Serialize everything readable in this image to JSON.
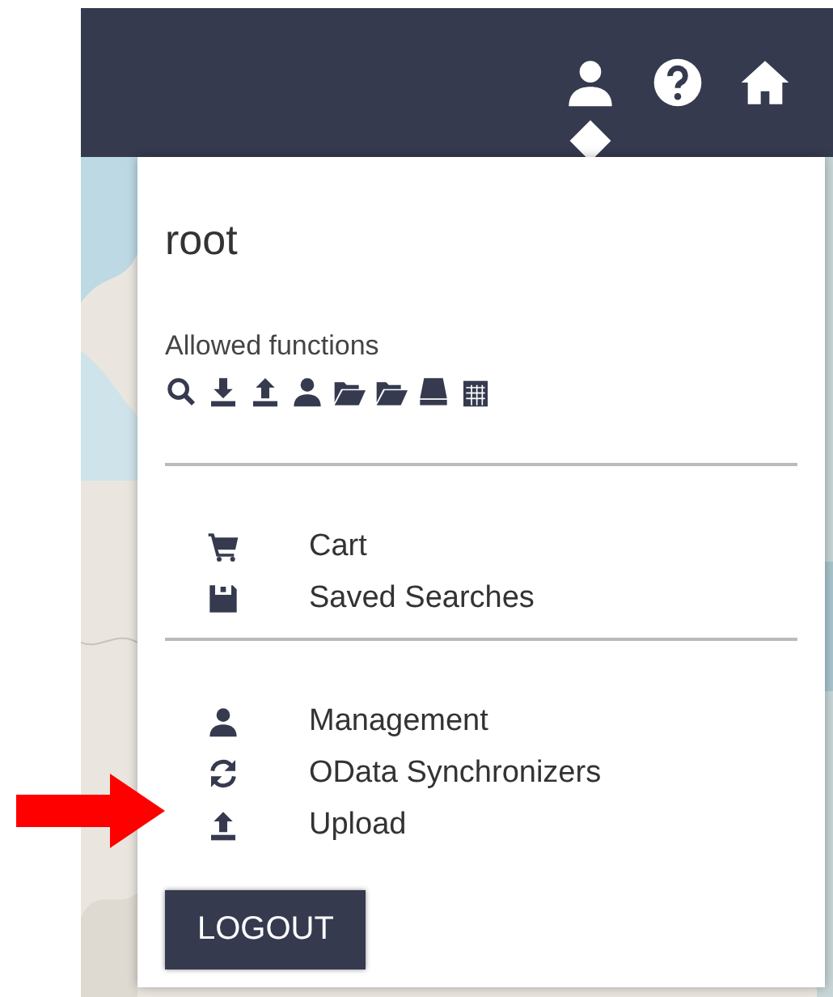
{
  "header": {
    "icons": [
      {
        "kind": "user",
        "selected": true
      },
      {
        "kind": "help"
      },
      {
        "kind": "home"
      }
    ]
  },
  "menu": {
    "username": "root",
    "allowed_label": "Allowed functions",
    "allowed_icons": [
      {
        "kind": "search"
      },
      {
        "kind": "download"
      },
      {
        "kind": "upload"
      },
      {
        "kind": "user"
      },
      {
        "kind": "folder"
      },
      {
        "kind": "folder"
      },
      {
        "kind": "drive"
      },
      {
        "kind": "calendar"
      }
    ],
    "groups": [
      [
        {
          "kind": "cart",
          "label": "Cart"
        },
        {
          "kind": "save",
          "label": "Saved Searches"
        }
      ],
      [
        {
          "kind": "user",
          "label": "Management"
        },
        {
          "kind": "refresh",
          "label": "OData Synchronizers"
        },
        {
          "kind": "upload",
          "label": "Upload"
        }
      ]
    ],
    "logout": "LOGOUT"
  },
  "annotation": {
    "kind": "arrow"
  }
}
